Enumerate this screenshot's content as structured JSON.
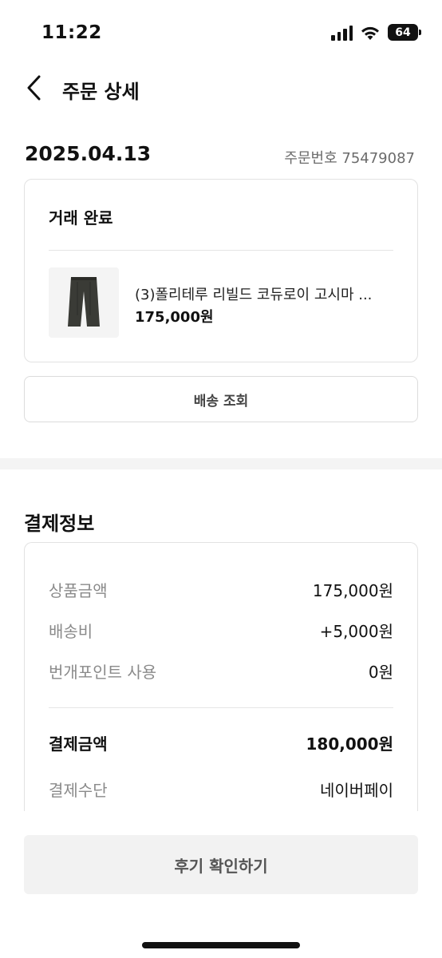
{
  "status_bar": {
    "time": "11:22",
    "battery": "64"
  },
  "nav": {
    "title": "주문 상세"
  },
  "order": {
    "date": "2025.04.13",
    "number": "주문번호 75479087"
  },
  "status_card": {
    "status": "거래 완료",
    "product": {
      "name": "(3)폴리테루 리빌드 코듀로이 고시마 ...",
      "price": "175,000원"
    }
  },
  "delivery_button": "배송 조회",
  "payment": {
    "title": "결제정보",
    "rows": [
      {
        "label": "상품금액",
        "value": "175,000원"
      },
      {
        "label": "배송비",
        "value": "+5,000원"
      },
      {
        "label": "번개포인트 사용",
        "value": "0원"
      }
    ],
    "total": {
      "label": "결제금액",
      "value": "180,000원"
    },
    "method": {
      "label": "결제수단",
      "value": "네이버페이"
    }
  },
  "review_button": "후기 확인하기"
}
